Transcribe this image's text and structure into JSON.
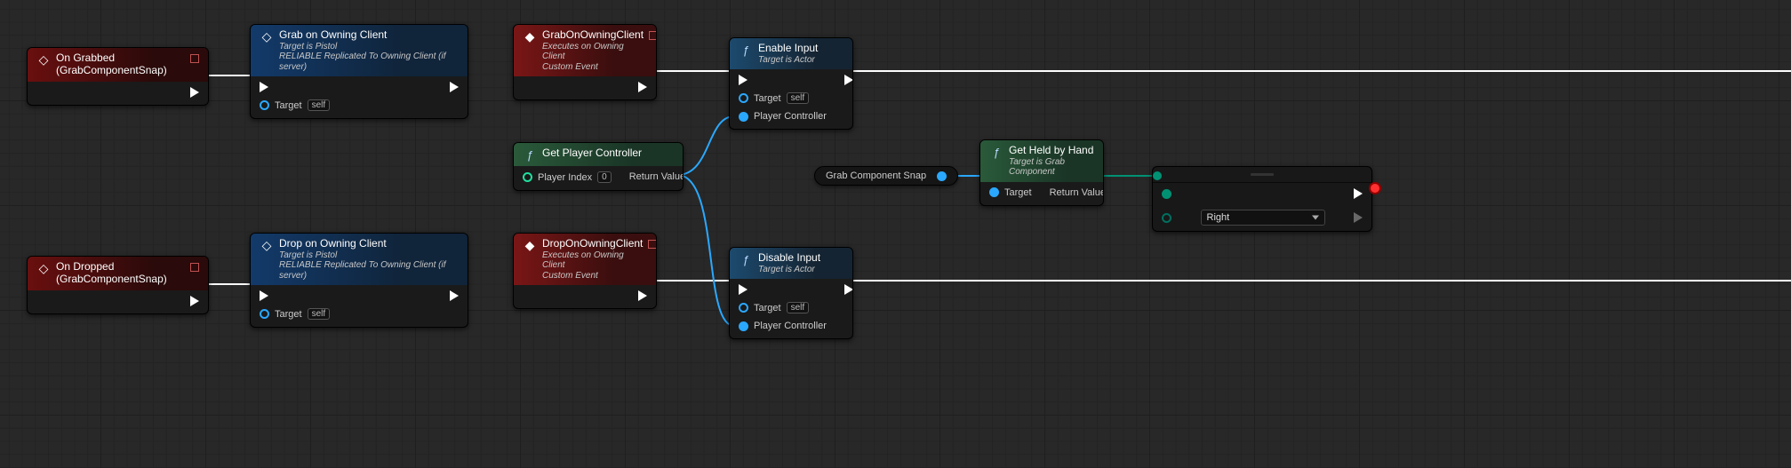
{
  "nodes": {
    "onGrabbed": {
      "title": "On Grabbed (GrabComponentSnap)"
    },
    "onDropped": {
      "title": "On Dropped (GrabComponentSnap)"
    },
    "grabOnOwning": {
      "title": "Grab on Owning Client",
      "sub1": "Target is Pistol",
      "sub2": "RELIABLE Replicated To Owning Client (if server)",
      "targetLabel": "Target",
      "selfLabel": "self"
    },
    "dropOnOwning": {
      "title": "Drop on Owning Client",
      "sub1": "Target is Pistol",
      "sub2": "RELIABLE Replicated To Owning Client (if server)",
      "targetLabel": "Target",
      "selfLabel": "self"
    },
    "grabEvent": {
      "title": "GrabOnOwningClient",
      "sub1": "Executes on Owning Client",
      "sub2": "Custom Event"
    },
    "dropEvent": {
      "title": "DropOnOwningClient",
      "sub1": "Executes on Owning Client",
      "sub2": "Custom Event"
    },
    "enableInput": {
      "title": "Enable Input",
      "sub1": "Target is Actor",
      "targetLabel": "Target",
      "selfLabel": "self",
      "pcLabel": "Player Controller"
    },
    "disableInput": {
      "title": "Disable Input",
      "sub1": "Target is Actor",
      "targetLabel": "Target",
      "selfLabel": "self",
      "pcLabel": "Player Controller"
    },
    "getPC": {
      "title": "Get Player Controller",
      "piLabel": "Player Index",
      "piVal": "0",
      "rvLabel": "Return Value"
    },
    "getHeld": {
      "title": "Get Held by Hand",
      "sub1": "Target is Grab Component",
      "targetLabel": "Target",
      "rvLabel": "Return Value"
    },
    "varGrab": {
      "label": "Grab Component Snap"
    },
    "switch": {
      "optionLabel": "Right"
    }
  }
}
